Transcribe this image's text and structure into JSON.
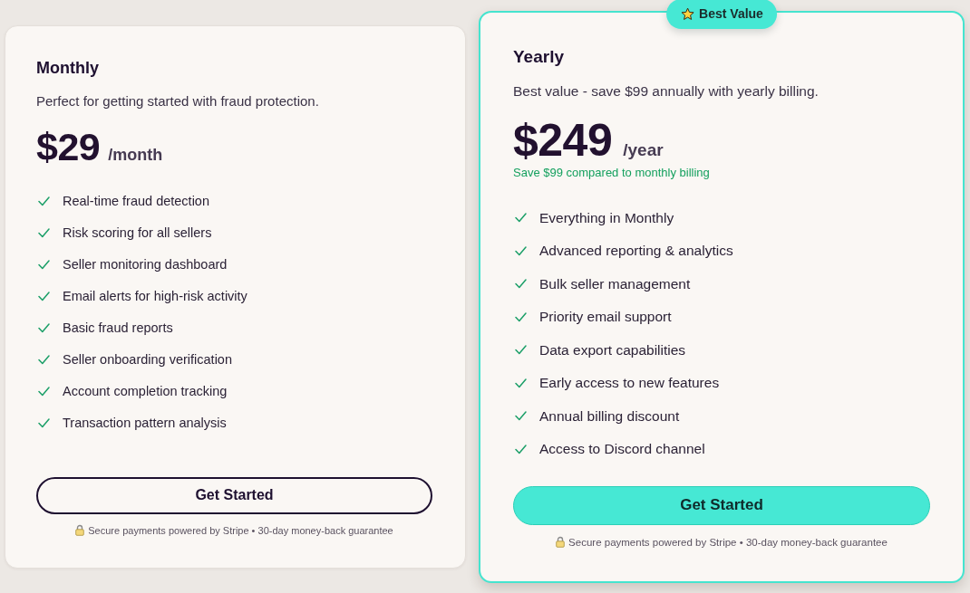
{
  "plans": [
    {
      "name": "Monthly",
      "featured": false,
      "description": "Perfect for getting started with fraud protection.",
      "price": "$29",
      "period": "/month",
      "features": [
        "Real-time fraud detection",
        "Risk scoring for all sellers",
        "Seller monitoring dashboard",
        "Email alerts for high-risk activity",
        "Basic fraud reports",
        "Seller onboarding verification",
        "Account completion tracking",
        "Transaction pattern analysis"
      ],
      "button": "Get Started",
      "footer": "Secure payments powered by Stripe • 30-day money-back guarantee"
    },
    {
      "name": "Yearly",
      "featured": true,
      "badge": "Best Value",
      "description": "Best value - save $99 annually with yearly billing.",
      "price": "$249",
      "period": "/year",
      "savings": "Save $99 compared to monthly billing",
      "features": [
        "Everything in Monthly",
        "Advanced reporting & analytics",
        "Bulk seller management",
        "Priority email support",
        "Data export capabilities",
        "Early access to new features",
        "Annual billing discount",
        "Access to Discord channel"
      ],
      "button": "Get Started",
      "footer": "Secure payments powered by Stripe • 30-day money-back guarantee"
    }
  ]
}
